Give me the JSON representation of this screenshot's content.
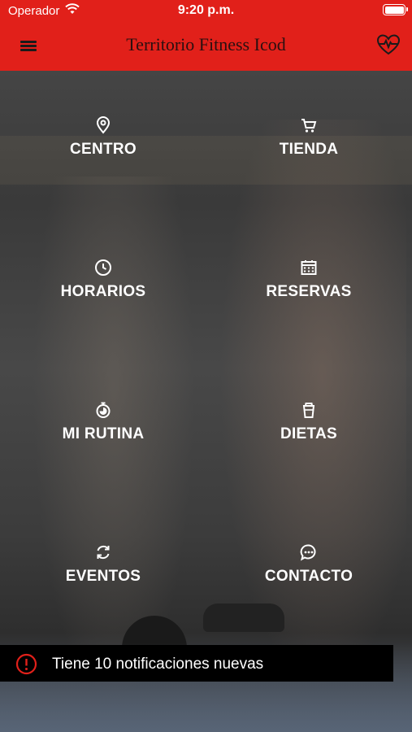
{
  "status_bar": {
    "carrier": "Operador",
    "time": "9:20 p.m."
  },
  "header": {
    "title": "Territorio Fitness Icod"
  },
  "menu": [
    {
      "label": "CENTRO",
      "icon": "location-pin-icon"
    },
    {
      "label": "TIENDA",
      "icon": "cart-icon"
    },
    {
      "label": "HORARIOS",
      "icon": "clock-icon"
    },
    {
      "label": "RESERVAS",
      "icon": "calendar-icon"
    },
    {
      "label": "MI RUTINA",
      "icon": "stopwatch-icon"
    },
    {
      "label": "DIETAS",
      "icon": "cup-icon"
    },
    {
      "label": "EVENTOS",
      "icon": "refresh-icon"
    },
    {
      "label": "CONTACTO",
      "icon": "chat-icon"
    }
  ],
  "notification": {
    "text": "Tiene 10 notificaciones nuevas",
    "icon": "alert-circle-icon"
  },
  "colors": {
    "header": "#e1201a",
    "notification_bg": "#000000",
    "alert": "#e1201a"
  }
}
